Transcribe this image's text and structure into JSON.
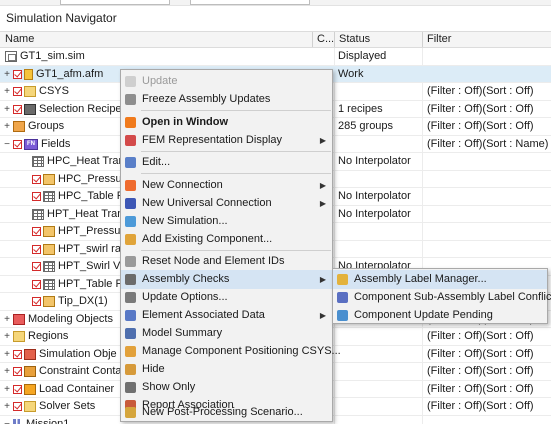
{
  "panel_title": "Simulation Navigator",
  "columns": {
    "name": "Name",
    "c": "C...",
    "status": "Status",
    "filter": "Filter"
  },
  "rows": [
    {
      "name": "GT1_sim.sim",
      "status": "Displayed",
      "filter": ""
    },
    {
      "name": "GT1_afm.afm",
      "status": "Work",
      "filter": ""
    },
    {
      "name": "CSYS",
      "status": "",
      "filter": "(Filter : Off)(Sort : Off)"
    },
    {
      "name": "Selection Recipe",
      "status": "1 recipes",
      "filter": "(Filter : Off)(Sort : Off)"
    },
    {
      "name": "Groups",
      "status": "285 groups",
      "filter": "(Filter : Off)(Sort : Off)"
    },
    {
      "name": "Fields",
      "status": "",
      "filter": "(Filter : Off)(Sort : Name)"
    },
    {
      "name": "HPC_Heat Trans",
      "status": "No Interpolator",
      "filter": ""
    },
    {
      "name": "HPC_Pressure",
      "status": "",
      "filter": ""
    },
    {
      "name": "HPC_Table Fie",
      "status": "No Interpolator",
      "filter": ""
    },
    {
      "name": "HPT_Heat Trans",
      "status": "No Interpolator",
      "filter": ""
    },
    {
      "name": "HPT_Pressure",
      "status": "",
      "filter": ""
    },
    {
      "name": "HPT_swirl rati",
      "status": "",
      "filter": ""
    },
    {
      "name": "HPT_Swirl Vel",
      "status": "No Interpolator",
      "filter": ""
    },
    {
      "name": "HPT_Table Fie",
      "status": "",
      "filter": ""
    },
    {
      "name": "Tip_DX(1)",
      "status": "",
      "filter": ""
    },
    {
      "name": "Modeling Objects",
      "status": "",
      "filter": "(Filter : Off)(Sort : Off)"
    },
    {
      "name": "Regions",
      "status": "",
      "filter": "(Filter : Off)(Sort : Off)"
    },
    {
      "name": "Simulation Obje",
      "status": "",
      "filter": "(Filter : Off)(Sort : Off)"
    },
    {
      "name": "Constraint Conta",
      "status": "",
      "filter": "(Filter : Off)(Sort : Off)"
    },
    {
      "name": "Load Container",
      "status": "",
      "filter": "(Filter : Off)(Sort : Off)"
    },
    {
      "name": "Solver Sets",
      "status": "",
      "filter": "(Filter : Off)(Sort : Off)"
    },
    {
      "name": "Mission1",
      "status": "",
      "filter": ""
    }
  ],
  "context_menu": [
    "Update",
    "Freeze Assembly Updates",
    "Open in Window",
    "FEM Representation Display",
    "Edit...",
    "New Connection",
    "New Universal Connection",
    "New Simulation...",
    "Add Existing Component...",
    "Reset Node and Element IDs",
    "Assembly Checks",
    "Update Options...",
    "Element Associated Data",
    "Model Summary",
    "Manage Component Positioning CSYS...",
    "Hide",
    "Show Only",
    "Report Association",
    "New Post-Processing Scenario..."
  ],
  "submenu": [
    "Assembly Label Manager...",
    "Component Sub-Assembly Label Conflicts",
    "Component Update Pending"
  ],
  "colors": {
    "selection": "#dcecf7",
    "menu_highlight": "#d5e4f3",
    "check_red": "#d42a2a"
  }
}
